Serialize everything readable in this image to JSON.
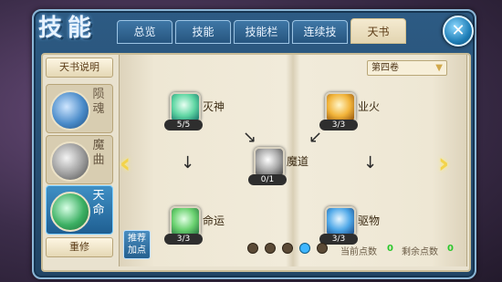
{
  "title": "技能",
  "tabs": [
    "总览",
    "技能",
    "技能栏",
    "连续技",
    "天书"
  ],
  "close_icon": "✕",
  "sidebar": {
    "book_info_label": "天书说明",
    "books": [
      {
        "name": "陨魂",
        "icon_color": "#4a8bc9"
      },
      {
        "name": "魔曲",
        "icon_color": "#9a9a9a"
      },
      {
        "name": "天命",
        "icon_color": "#3cb063"
      }
    ],
    "reset_label": "重修"
  },
  "recommend_label": "推荐加点",
  "volume_select": "第四卷",
  "skills": {
    "top_left": {
      "name": "灭神",
      "count": "5/5"
    },
    "top_right": {
      "name": "业火",
      "count": "3/3"
    },
    "center": {
      "name": "魔道",
      "count": "0/1"
    },
    "bottom_left": {
      "name": "命运",
      "count": "3/3"
    },
    "bottom_right": {
      "name": "驱物",
      "count": "3/3"
    }
  },
  "page_dots": 5,
  "current_page": 4,
  "points": {
    "current_label": "当前点数",
    "current_value": "0",
    "remaining_label": "剩余点数",
    "remaining_value": "0"
  },
  "nav": {
    "prev": "‹",
    "next": "›"
  },
  "arrow_symbols": {
    "diag_right": "↘",
    "diag_left": "↙",
    "down": "↓"
  }
}
